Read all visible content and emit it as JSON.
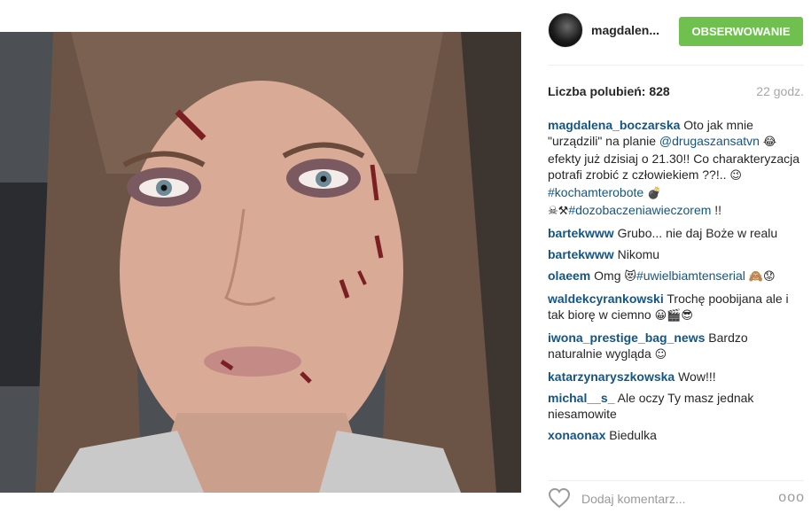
{
  "post": {
    "author": "magdalen...",
    "follow_label": "OBSERWOWANIE",
    "likes_text": "Liczba polubień: 828",
    "time_ago": "22 godz."
  },
  "caption": {
    "user": "magdalena_boczarska",
    "text_1": "Oto jak mnie \"urządzili\" na planie ",
    "mention": "@drugaszansatvn",
    "emoji_1": "😂",
    "text_2": " efekty już dzisiaj o 21.30!! Co charakteryzacja potrafi zrobić z człowiekiem ??!.. ",
    "emoji_2": "😉",
    "hashtag_1": "#kochamterobote",
    "emoji_3": "💣☠⚒",
    "hashtag_2": "#dozobaczeniawieczorem",
    "text_3": " !!"
  },
  "comments": [
    {
      "user": "bartekwww",
      "text": "Grubo... nie daj Boże w realu",
      "emoji": "",
      "tag": ""
    },
    {
      "user": "bartekwww",
      "text": "Nikomu",
      "emoji": "",
      "tag": ""
    },
    {
      "user": "olaeem",
      "text": "Omg ",
      "emoji": "😻",
      "tag": "#uwielbiamtenserial",
      "emoji_after": "🙈😟"
    },
    {
      "user": "waldekcyrankowski",
      "text": "Trochę poobijana ale i tak biorę w ciemno ",
      "emoji": "😀🎬😎",
      "tag": ""
    },
    {
      "user": "iwona_prestige_bag_news",
      "text": "Bardzo naturalnie wygląda ",
      "emoji": "☺",
      "tag": ""
    },
    {
      "user": "katarzynaryszkowska",
      "text": "Wow!!!",
      "emoji": "",
      "tag": ""
    },
    {
      "user": "michal__s_",
      "text": "Ale oczy Ty masz jednak niesamowite",
      "emoji": "",
      "tag": ""
    },
    {
      "user": "xonaonax",
      "text": "Biedulka",
      "emoji": "",
      "tag": ""
    }
  ],
  "footer": {
    "comment_placeholder": "Dodaj komentarz...",
    "more_label": "ooo"
  },
  "icons": {
    "like": "heart-icon",
    "more": "more-options-icon"
  },
  "colors": {
    "follow_bg": "#70c050",
    "link": "#125688"
  }
}
